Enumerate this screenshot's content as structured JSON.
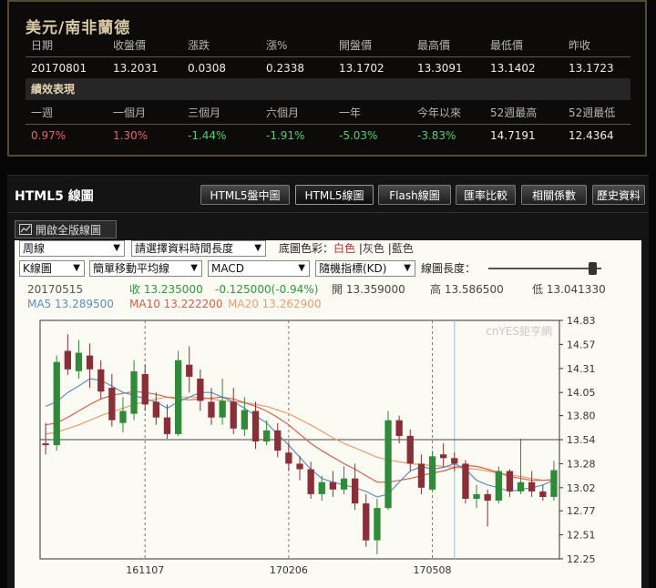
{
  "quote": {
    "title": "美元/南非蘭德",
    "headers": [
      "日期",
      "收盤價",
      "漲跌",
      "漲%",
      "開盤價",
      "最高價",
      "最低價",
      "昨收"
    ],
    "values": [
      "20170801",
      "13.2031",
      "0.0308",
      "0.2338",
      "13.1702",
      "13.3091",
      "13.1402",
      "13.1723"
    ]
  },
  "performance": {
    "title": "績效表現",
    "headers": [
      "一週",
      "一個月",
      "三個月",
      "六個月",
      "一年",
      "今年以來",
      "52週最高",
      "52週最低"
    ],
    "values": [
      "0.97%",
      "1.30%",
      "-1.44%",
      "-1.91%",
      "-5.03%",
      "-3.83%",
      "14.7191",
      "12.4364"
    ],
    "colors": [
      "#e86464",
      "#e86464",
      "#4fd16a",
      "#4fd16a",
      "#4fd16a",
      "#4fd16a",
      "#eeeeee",
      "#eeeeee"
    ]
  },
  "panel": {
    "title": "HTML5 線圖",
    "tabs": [
      "HTML5盤中圖",
      "HTML5線圖",
      "Flash線圖",
      "匯率比較",
      "相關係數",
      "歷史資料"
    ],
    "active_tab": 1,
    "full_button": "開啟全版線圖"
  },
  "controls": {
    "period": "周線",
    "range": "請選擇資料時間長度",
    "bg_label": "底圖色彩：",
    "bg_white": "白色",
    "bg_gray": "灰色",
    "bg_blue": "藍色",
    "sep": "|",
    "chart_type": "K線圖",
    "ma_type": "簡單移動平均線",
    "indicator1": "MACD",
    "indicator2": "隨機指標(KD)",
    "length_label": "線圖長度："
  },
  "info": {
    "date": "20170515",
    "close": "收 13.235000",
    "change": "-0.125000(-0.94%)",
    "open": "開 13.359000",
    "high": "高 13.586500",
    "low": "低 13.041330",
    "ma5": "MA5 13.289500",
    "ma10": "MA10 13.222200",
    "ma20": "MA20 13.262900"
  },
  "colors": {
    "up": "#2f8a3a",
    "down": "#8a2e38",
    "ma5": "#5b8fc0",
    "ma10": "#d8604a",
    "ma20": "#e8a070",
    "change": "#2a9a3a",
    "accent": "#d8c9a6"
  },
  "chart_data": {
    "type": "candlestick",
    "watermark": "cnYES鉅亨網",
    "y_ticks": [
      "14.83",
      "14.57",
      "14.31",
      "14.05",
      "13.80",
      "13.54",
      "13.28",
      "13.02",
      "12.77",
      "12.51",
      "12.25"
    ],
    "ylim": [
      12.25,
      14.83
    ],
    "x_ticks": [
      {
        "index": 9,
        "label": "161107"
      },
      {
        "index": 22,
        "label": "170206"
      },
      {
        "index": 35,
        "label": "170508"
      }
    ],
    "reference_level": 13.54,
    "candles": [
      [
        13.5,
        13.48,
        13.72,
        13.38
      ],
      [
        13.48,
        14.38,
        14.45,
        13.42
      ],
      [
        14.5,
        14.3,
        14.68,
        14.24
      ],
      [
        14.28,
        14.48,
        14.62,
        14.2
      ],
      [
        14.45,
        14.3,
        14.58,
        14.1
      ],
      [
        14.3,
        14.06,
        14.4,
        13.98
      ],
      [
        14.1,
        13.75,
        14.25,
        13.68
      ],
      [
        13.72,
        13.85,
        14.0,
        13.62
      ],
      [
        13.82,
        14.28,
        14.4,
        13.75
      ],
      [
        14.25,
        13.92,
        14.35,
        13.85
      ],
      [
        13.95,
        13.78,
        14.05,
        13.7
      ],
      [
        13.78,
        13.6,
        13.92,
        13.55
      ],
      [
        13.6,
        14.4,
        14.5,
        13.58
      ],
      [
        14.35,
        14.22,
        14.55,
        14.05
      ],
      [
        14.2,
        13.96,
        14.3,
        13.85
      ],
      [
        13.95,
        13.78,
        14.1,
        13.7
      ],
      [
        13.78,
        13.96,
        14.2,
        13.7
      ],
      [
        13.95,
        13.66,
        14.1,
        13.6
      ],
      [
        13.65,
        13.86,
        14.0,
        13.58
      ],
      [
        13.85,
        13.52,
        13.95,
        13.44
      ],
      [
        13.52,
        13.64,
        13.75,
        13.48
      ],
      [
        13.64,
        13.42,
        13.72,
        13.35
      ],
      [
        13.4,
        13.28,
        13.5,
        13.2
      ],
      [
        13.28,
        13.22,
        13.36,
        13.1
      ],
      [
        13.22,
        12.95,
        13.3,
        12.9
      ],
      [
        12.95,
        13.08,
        13.15,
        12.88
      ],
      [
        13.08,
        13.0,
        13.2,
        12.92
      ],
      [
        13.0,
        13.12,
        13.25,
        12.95
      ],
      [
        13.12,
        12.85,
        13.28,
        12.78
      ],
      [
        12.85,
        12.45,
        12.95,
        12.38
      ],
      [
        12.45,
        12.8,
        12.9,
        12.3
      ],
      [
        12.8,
        13.75,
        13.85,
        12.78
      ],
      [
        13.75,
        13.58,
        13.8,
        13.5
      ],
      [
        13.58,
        13.28,
        13.65,
        13.2
      ],
      [
        13.28,
        13.02,
        13.38,
        12.95
      ],
      [
        13.0,
        13.36,
        13.42,
        12.98
      ],
      [
        13.38,
        13.34,
        13.5,
        13.25
      ],
      [
        13.34,
        13.28,
        13.4,
        13.2
      ],
      [
        13.28,
        12.9,
        13.32,
        12.85
      ],
      [
        12.9,
        12.95,
        13.05,
        12.8
      ],
      [
        12.95,
        12.88,
        13.0,
        12.6
      ],
      [
        12.88,
        13.2,
        13.25,
        12.85
      ],
      [
        13.2,
        12.98,
        13.22,
        12.92
      ],
      [
        12.98,
        13.08,
        13.55,
        12.95
      ],
      [
        13.08,
        12.98,
        13.2,
        12.92
      ],
      [
        12.98,
        12.92,
        13.05,
        12.88
      ],
      [
        12.92,
        13.21,
        13.31,
        12.88
      ]
    ],
    "ma5": [
      13.9,
      13.95,
      14.05,
      14.12,
      14.2,
      14.18,
      14.12,
      14.05,
      14.02,
      13.98,
      13.95,
      13.88,
      13.95,
      14.0,
      14.05,
      14.05,
      14.0,
      13.95,
      13.88,
      13.8,
      13.72,
      13.6,
      13.48,
      13.35,
      13.22,
      13.12,
      13.08,
      13.05,
      13.02,
      12.98,
      12.92,
      12.95,
      13.08,
      13.2,
      13.25,
      13.22,
      13.24,
      13.28,
      13.22,
      13.1,
      13.05,
      13.02,
      12.98,
      13.0,
      13.02,
      13.05,
      13.1
    ],
    "ma10": [
      13.7,
      13.72,
      13.78,
      13.85,
      13.92,
      13.98,
      14.02,
      14.04,
      14.06,
      14.05,
      14.03,
      14.0,
      13.98,
      13.97,
      13.98,
      13.99,
      14.0,
      13.98,
      13.94,
      13.9,
      13.85,
      13.78,
      13.7,
      13.6,
      13.5,
      13.42,
      13.35,
      13.28,
      13.22,
      13.15,
      13.08,
      13.08,
      13.1,
      13.12,
      13.15,
      13.18,
      13.2,
      13.24,
      13.26,
      13.25,
      13.22,
      13.18,
      13.14,
      13.12,
      13.1,
      13.1,
      13.11
    ],
    "ma20": [
      13.6,
      13.62,
      13.66,
      13.7,
      13.75,
      13.8,
      13.84,
      13.88,
      13.92,
      13.95,
      13.98,
      14.0,
      14.0,
      14.0,
      14.0,
      13.98,
      13.96,
      13.95,
      13.94,
      13.92,
      13.9,
      13.86,
      13.82,
      13.76,
      13.7,
      13.63,
      13.56,
      13.5,
      13.45,
      13.4,
      13.35,
      13.32,
      13.3,
      13.28,
      13.27,
      13.26,
      13.25,
      13.24,
      13.23,
      13.22,
      13.2,
      13.18,
      13.16,
      13.14,
      13.12,
      13.1,
      13.1
    ]
  }
}
